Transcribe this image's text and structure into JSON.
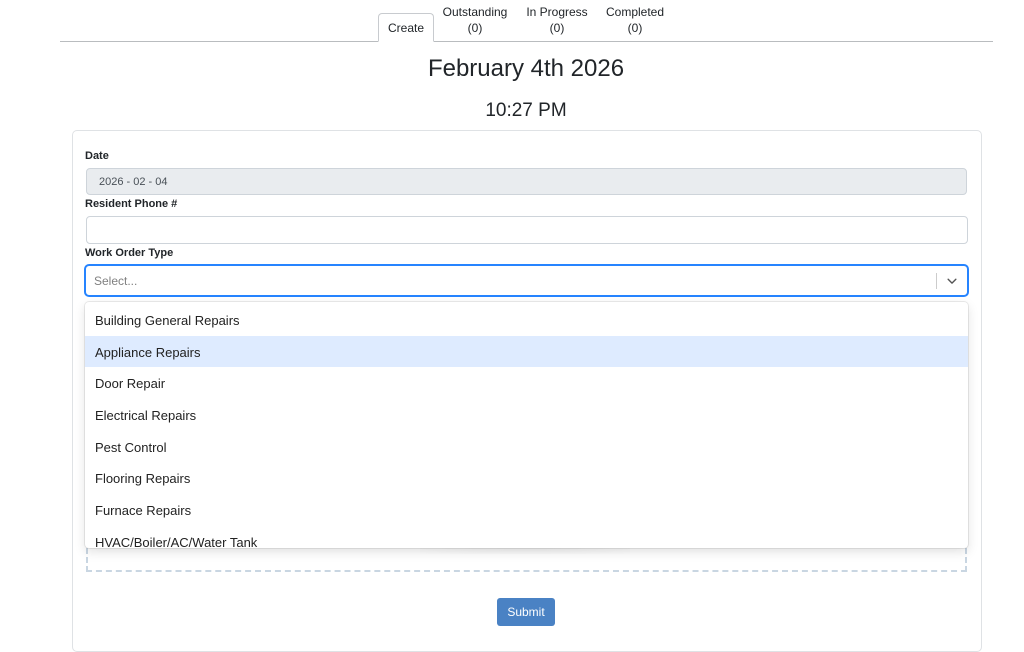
{
  "tabs": [
    {
      "label": "Create",
      "count": ""
    },
    {
      "label": "Outstanding",
      "count": "(0)"
    },
    {
      "label": "In Progress",
      "count": "(0)"
    },
    {
      "label": "Completed",
      "count": "(0)"
    }
  ],
  "header": {
    "date": "February 4th 2026",
    "time": "10:27 PM"
  },
  "form": {
    "date_label": "Date",
    "date_value": "2026 - 02 - 04",
    "phone_label": "Resident Phone #",
    "phone_value": "",
    "type_label": "Work Order Type",
    "type_placeholder": "Select...",
    "options": [
      "Building General Repairs",
      "Appliance Repairs",
      "Door Repair",
      "Electrical Repairs",
      "Pest Control",
      "Flooring Repairs",
      "Furnace Repairs",
      "HVAC/Boiler/AC/Water Tank"
    ],
    "highlighted_option": "Appliance Repairs",
    "submit_label": "Submit"
  },
  "colors": {
    "accent": "#4a82c4",
    "focus": "#2684ff",
    "highlight": "#deebff"
  },
  "icons": {
    "select_indicator": "chevron-down-icon"
  }
}
